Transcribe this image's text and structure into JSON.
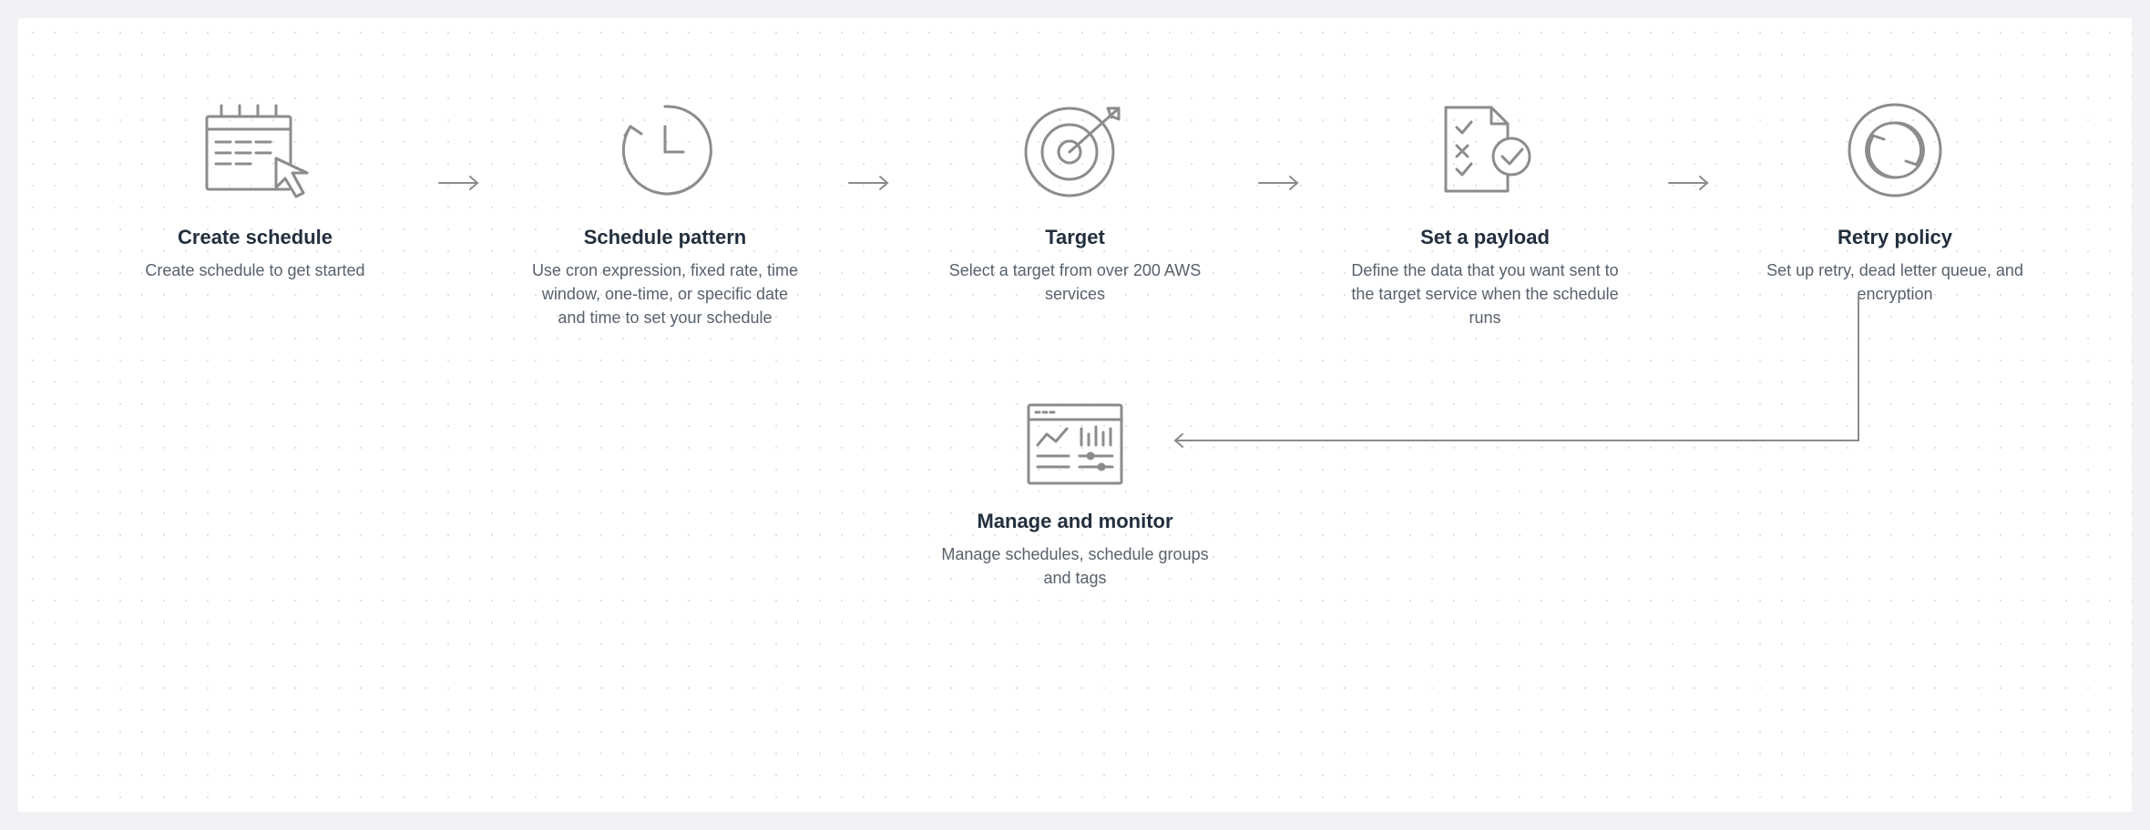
{
  "steps": {
    "create": {
      "title": "Create schedule",
      "desc": "Create schedule to get started"
    },
    "pattern": {
      "title": "Schedule pattern",
      "desc": "Use cron expression, fixed rate, time window, one-time, or specific date and time to set your schedule"
    },
    "target": {
      "title": "Target",
      "desc": "Select a target from over 200 AWS services"
    },
    "payload": {
      "title": "Set a payload",
      "desc": "Define the data that you want sent to the target service when the schedule runs"
    },
    "retry": {
      "title": "Retry policy",
      "desc": "Set up retry, dead letter queue, and encryption"
    },
    "manage": {
      "title": "Manage and monitor",
      "desc": "Manage schedules, schedule groups and tags"
    }
  }
}
